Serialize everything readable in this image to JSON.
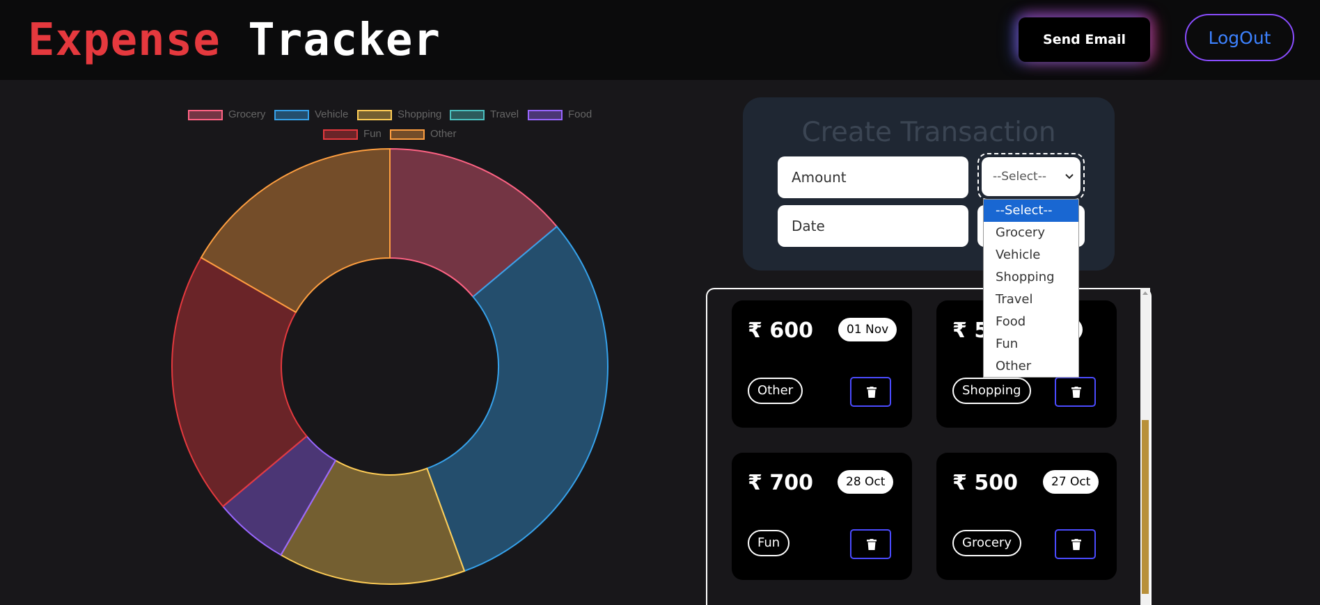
{
  "header": {
    "logo_part1": "Expense",
    "logo_part2": "Tracker",
    "send_email_label": "Send Email",
    "logout_label": "LogOut"
  },
  "chart_data": {
    "type": "doughnut",
    "legend_position": "top",
    "categories": [
      "Grocery",
      "Vehicle",
      "Shopping",
      "Travel",
      "Food",
      "Fun",
      "Other"
    ],
    "values": [
      500,
      1100,
      500,
      0,
      200,
      700,
      600
    ],
    "colors": [
      "#ff6384",
      "#36a2eb",
      "#ffcd56",
      "#4bc0c0",
      "#9966ff",
      "#e5393e",
      "#ff9f40"
    ]
  },
  "create": {
    "title": "Create Transaction",
    "amount_placeholder": "Amount",
    "date_placeholder": "Date",
    "select_value": "--Select--",
    "options": [
      "--Select--",
      "Grocery",
      "Vehicle",
      "Shopping",
      "Travel",
      "Food",
      "Fun",
      "Other"
    ]
  },
  "transactions": [
    {
      "amount": "₹ 600",
      "date": "01 Nov",
      "category": "Other"
    },
    {
      "amount": "₹ 5",
      "date": "ct",
      "category": "Shopping"
    },
    {
      "amount": "₹ 700",
      "date": "28 Oct",
      "category": "Fun"
    },
    {
      "amount": "₹ 500",
      "date": "27 Oct",
      "category": "Grocery"
    }
  ]
}
